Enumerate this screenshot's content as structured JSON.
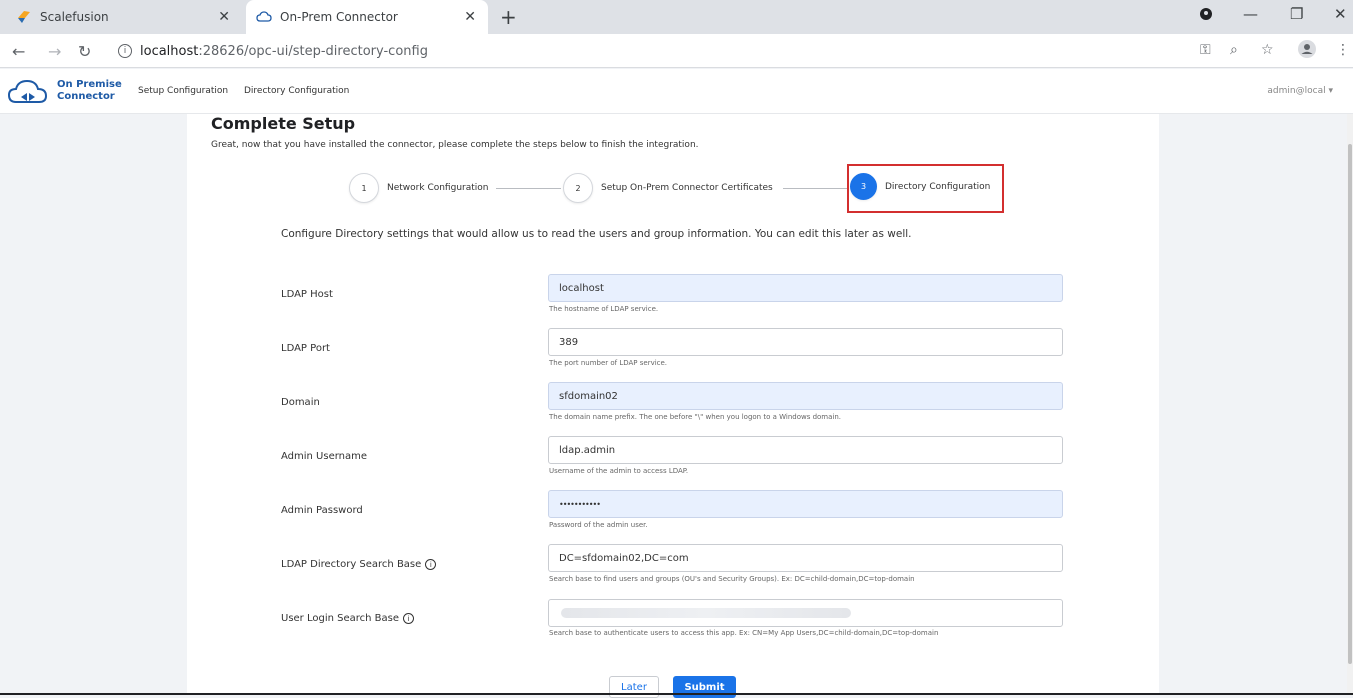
{
  "browser": {
    "tabs": [
      {
        "title": "Scalefusion"
      },
      {
        "title": "On-Prem Connector"
      }
    ],
    "url_host": "localhost",
    "url_rest": ":28626/opc-ui/step-directory-config"
  },
  "app": {
    "brand_line1": "On Premise",
    "brand_line2": "Connector",
    "nav": [
      "Setup Configuration",
      "Directory Configuration"
    ],
    "user": "admin@local"
  },
  "page": {
    "title": "Complete Setup",
    "subtitle": "Great, now that you have installed the connector, please complete the steps below to finish the integration.",
    "intro": "Configure Directory settings that would allow us to read the users and group information. You can edit this later as well."
  },
  "steps": [
    {
      "num": "1",
      "label": "Network Configuration"
    },
    {
      "num": "2",
      "label": "Setup On-Prem Connector Certificates"
    },
    {
      "num": "3",
      "label": "Directory Configuration"
    }
  ],
  "form": {
    "ldap_host": {
      "label": "LDAP Host",
      "value": "localhost",
      "help": "The hostname of LDAP service."
    },
    "ldap_port": {
      "label": "LDAP Port",
      "value": "389",
      "help": "The port number of LDAP service."
    },
    "domain": {
      "label": "Domain",
      "value": "sfdomain02",
      "help": "The domain name prefix. The one before \"\\\" when you logon to a Windows domain."
    },
    "admin_username": {
      "label": "Admin Username",
      "value": "ldap.admin",
      "help": "Username of the admin to access LDAP."
    },
    "admin_password": {
      "label": "Admin Password",
      "value": "•••••••••••",
      "help": "Password of the admin user."
    },
    "search_base": {
      "label": "LDAP Directory Search Base",
      "value": "DC=sfdomain02,DC=com",
      "help": "Search base to find users and groups (OU's and Security Groups). Ex: DC=child-domain,DC=top-domain"
    },
    "login_search_base": {
      "label": "User Login Search Base",
      "value": "",
      "help": "Search base to authenticate users to access this app. Ex: CN=My App Users,DC=child-domain,DC=top-domain"
    }
  },
  "buttons": {
    "later": "Later",
    "submit": "Submit"
  }
}
